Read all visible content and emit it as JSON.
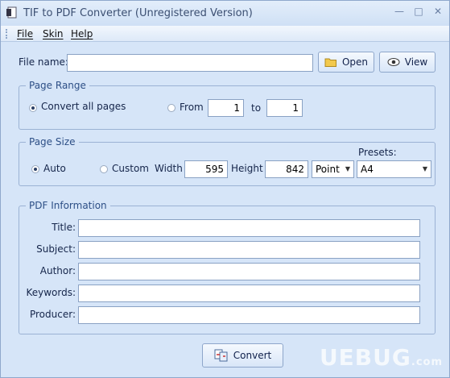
{
  "window": {
    "title": "TIF to PDF Converter (Unregistered Version)"
  },
  "menu": {
    "file": "File",
    "skin": "Skin",
    "help": "Help"
  },
  "file": {
    "label": "File name:",
    "value": "",
    "open": "Open",
    "view": "View"
  },
  "page_range": {
    "title": "Page Range",
    "convert_all": "Convert all pages",
    "from_label": "From",
    "from_value": "1",
    "to_label": "to",
    "to_value": "1",
    "selected": "convert_all"
  },
  "page_size": {
    "title": "Page Size",
    "auto": "Auto",
    "custom": "Custom",
    "width_label": "Width",
    "width_value": "595",
    "height_label": "Height",
    "height_value": "842",
    "unit": "Point",
    "presets_label": "Presets:",
    "preset": "A4",
    "selected": "auto"
  },
  "pdf_info": {
    "title": "PDF Information",
    "title_label": "Title:",
    "subject_label": "Subject:",
    "author_label": "Author:",
    "keywords_label": "Keywords:",
    "producer_label": "Producer:"
  },
  "convert_button": "Convert",
  "watermark": {
    "main": "UEBUG",
    "suffix": ".com"
  }
}
